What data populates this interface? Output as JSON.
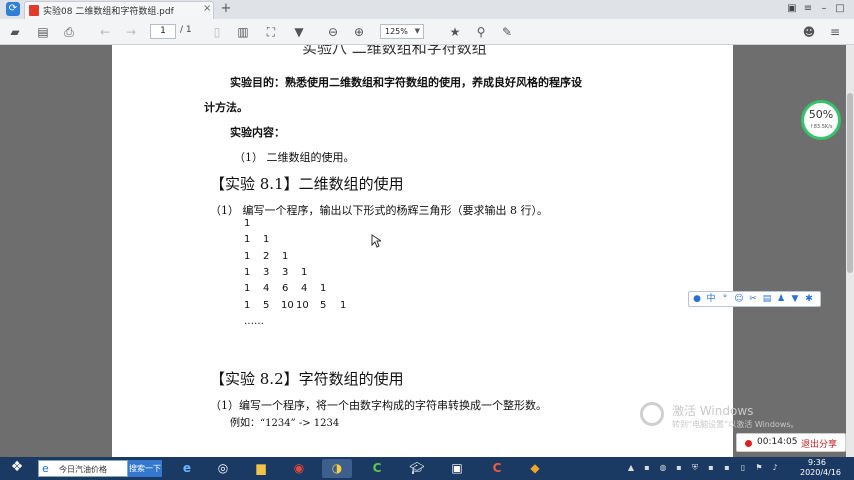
{
  "window": {
    "tab_title": "实验08 二维数组和字符数组.pdf",
    "close_tab": "×",
    "new_tab": "+"
  },
  "toolbar": {
    "current_page": "1",
    "total_pages": "/ 1",
    "zoom": "125%"
  },
  "document": {
    "title": "实验八  二维数组和字符数组",
    "aim_line1": "实验目的：熟悉使用二维数组和字符数组的使用，养成良好风格的程序设",
    "aim_line2": "计方法。",
    "content_label": "实验内容：",
    "content_item": "（1）  二维数组的使用。",
    "heading_81": "【实验 8.1】二维数组的使用",
    "task1": "（1）  编写一个程序，输出以下形式的杨辉三角形（要求输出 8 行）。",
    "triangle": [
      [
        "1"
      ],
      [
        "1",
        "1"
      ],
      [
        "1",
        "2",
        "1"
      ],
      [
        "1",
        "3",
        "3",
        "1"
      ],
      [
        "1",
        "4",
        "6",
        "4",
        "1"
      ],
      [
        "1",
        "5",
        "10",
        "10",
        "5",
        "1"
      ]
    ],
    "ellipsis": "……",
    "heading_82": "【实验 8.2】字符数组的使用",
    "task2": "（1）编写一个程序，将一个由数字构成的字符串转换成一个整形数。",
    "example": "例如：“1234” -> 1234"
  },
  "widgets": {
    "speed_percent": "50%",
    "speed_rate": "↑83.5K/s",
    "ime_mode": "中",
    "activate_title": "激活 Windows",
    "activate_sub": "转到“电脑设置”以激活 Windows。",
    "rec_time": "00:14:05",
    "rec_exit": "退出分享"
  },
  "taskbar": {
    "search_placeholder": "今日汽油价格",
    "search_button": "搜索一下",
    "clock_time": "9:36",
    "clock_date": "2020/4/16"
  }
}
